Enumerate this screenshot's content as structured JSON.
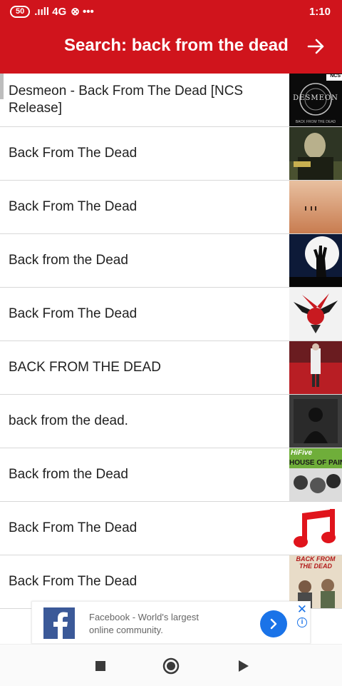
{
  "status_bar": {
    "battery": "50",
    "network": ".ııll 4G",
    "icons": "⊗ •••",
    "time": "1:10"
  },
  "header": {
    "title": "Search: back from the dead",
    "go_icon": "arrow-right-icon"
  },
  "results": [
    {
      "title": "Desmeon - Back From The Dead [NCS Release]",
      "thumb_label": "DESMEON",
      "thumb_badge": "NCS",
      "thumb_caption": "BACK FROM THE DEAD"
    },
    {
      "title": "Back From The Dead"
    },
    {
      "title": "Back From The Dead"
    },
    {
      "title": "Back from the Dead"
    },
    {
      "title": "Back From The Dead"
    },
    {
      "title": "BACK FROM THE DEAD"
    },
    {
      "title": "back from the dead."
    },
    {
      "title": "Back from the Dead",
      "thumb_label": "HOUSE OF PAIN",
      "thumb_badge": "HiFive"
    },
    {
      "title": "Back From The Dead"
    },
    {
      "title": "Back From The Dead",
      "thumb_label": "BACK FROM THE DEAD"
    }
  ],
  "ad": {
    "text": "Facebook - World's largest online community.",
    "close_label": "✕",
    "info_label": "i"
  },
  "colors": {
    "header_bg": "#d0141c",
    "ad_accent": "#1a73e8",
    "facebook": "#3b5998"
  }
}
